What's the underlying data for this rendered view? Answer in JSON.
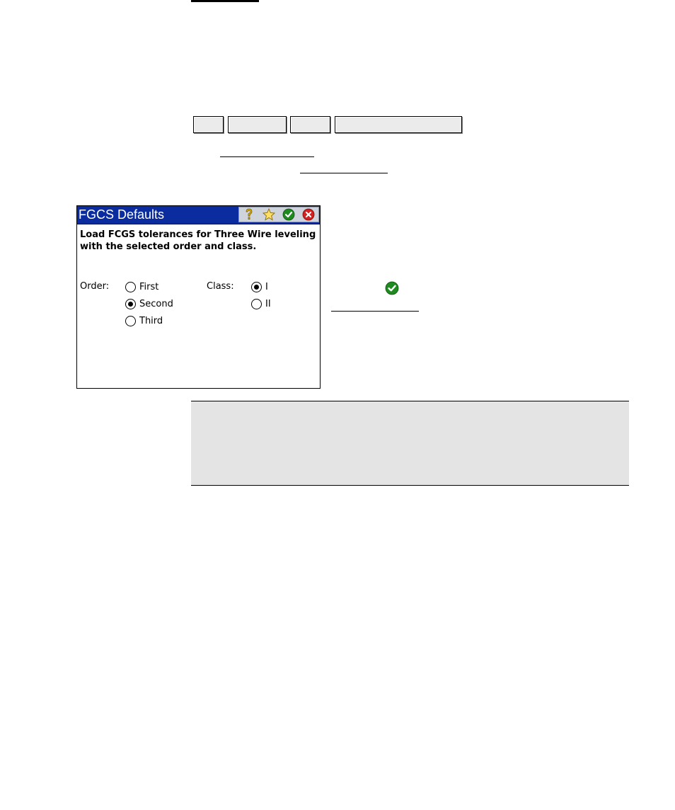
{
  "dialog": {
    "title": "FGCS Defaults",
    "instruction": "Load FCGS tolerances for Three Wire leveling with the selected order and class.",
    "order": {
      "label": "Order:",
      "options": [
        "First",
        "Second",
        "Third"
      ],
      "selected": "Second"
    },
    "class": {
      "label": "Class:",
      "options": [
        "I",
        "II"
      ],
      "selected": "I"
    },
    "titlebar_icons": [
      "help-icon",
      "favorites-icon",
      "accept-icon",
      "close-icon"
    ]
  },
  "colors": {
    "titlebar": "#0a2c9e",
    "accept": "#1f8a1f",
    "close": "#d42020",
    "note_background": "#e4e4e4"
  }
}
